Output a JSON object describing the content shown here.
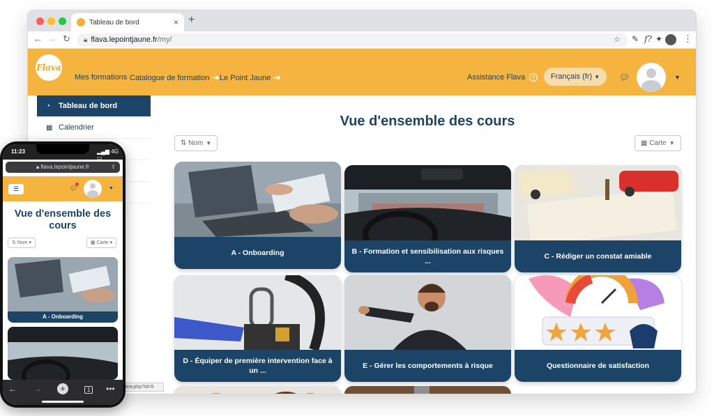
{
  "browser": {
    "tab_title": "Tableau de bord",
    "tab_close": "×",
    "new_tab": "+",
    "url_host": "flava.lepointjaune.fr",
    "url_path": "/my/",
    "status_url": "view.php?id=5"
  },
  "site": {
    "logo_text": "Flava",
    "nav": [
      "Mes formations",
      "Catalogue de formation",
      "Le Point Jaune"
    ],
    "help_label": "Assistance Flava",
    "help_icon": "?",
    "language": "Français (fr)"
  },
  "sidebar": {
    "items": [
      {
        "label": "Tableau de bord",
        "icon": "dashboard-icon",
        "active": true
      },
      {
        "label": "Calendrier",
        "icon": "calendar-icon",
        "active": false
      }
    ]
  },
  "main": {
    "title": "Vue d'ensemble des cours",
    "sort_label": "Nom",
    "view_label": "Carte",
    "courses": [
      "A - Onboarding",
      "B - Formation et sensibilisation aux risques ...",
      "C - Rédiger un constat amiable",
      "D - Équiper de première intervention face à un ...",
      "E - Gérer les comportements à risque",
      "Questionnaire de satisfaction"
    ]
  },
  "phone": {
    "time": "11:23",
    "network": "4G",
    "url": "flava.lepointjaune.fr",
    "title": "Vue d'ensemble des cours",
    "sort_label": "Nom",
    "view_label": "Carte",
    "first_course": "A - Onboarding",
    "tab_count": "1"
  },
  "colors": {
    "brand_yellow": "#f5b43f",
    "brand_navy": "#1b4466"
  }
}
